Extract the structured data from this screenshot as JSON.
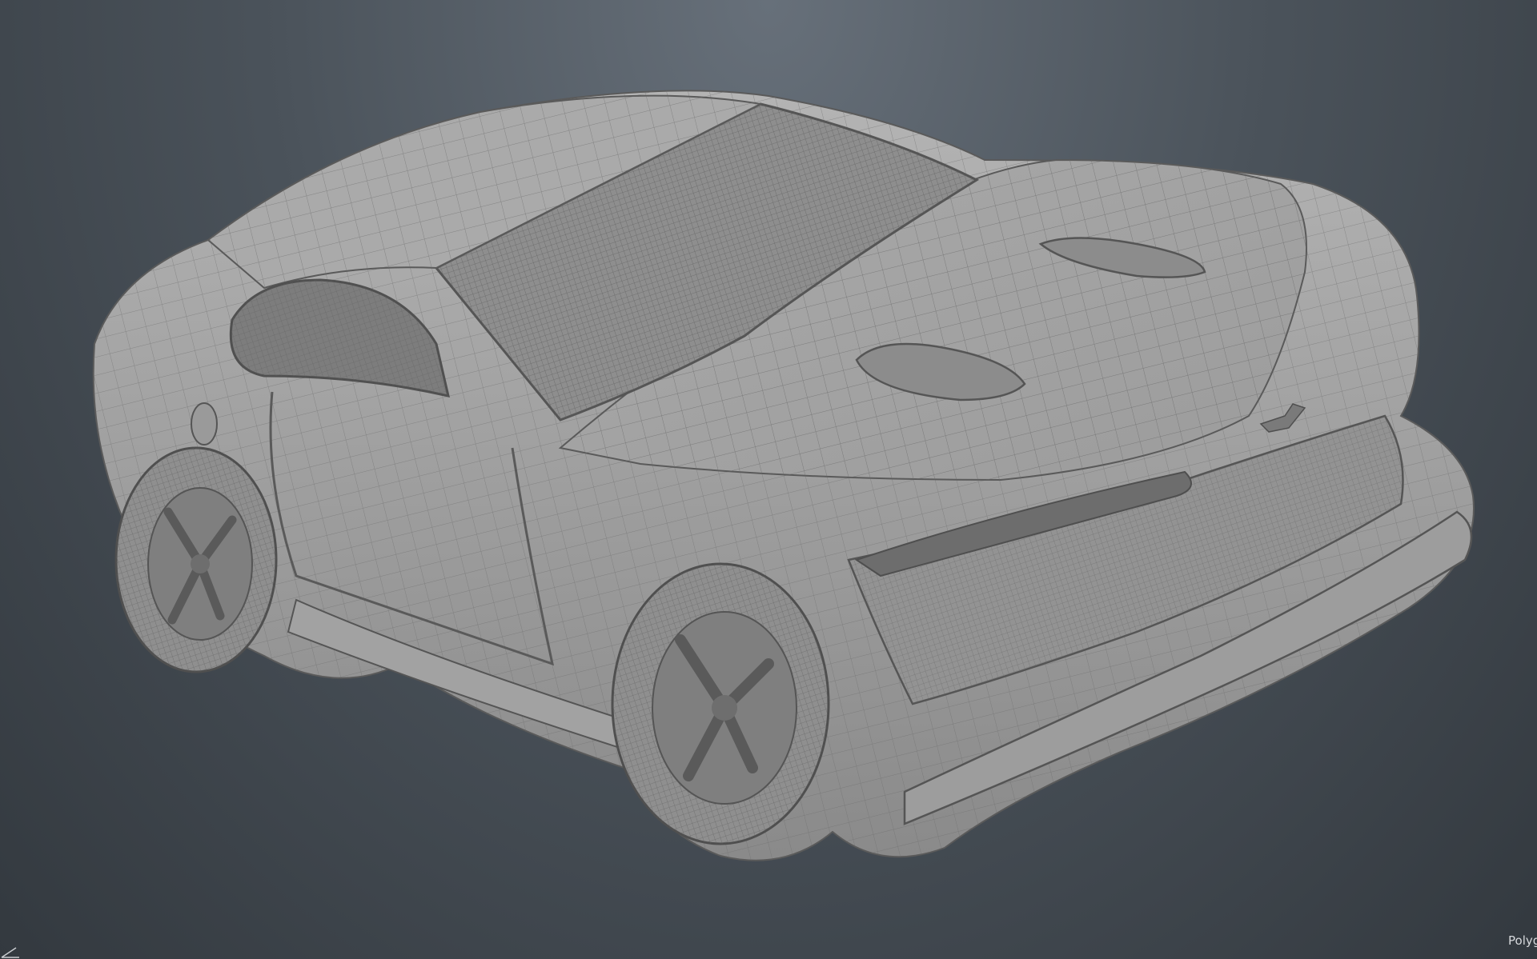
{
  "viewport": {
    "background": "#4b535b",
    "mesh_color": "#9a9a9a",
    "wire_color": "#6f6f6f",
    "status_text": "Polyg"
  },
  "icons": {
    "corner_gizmo": "axis-gizmo-icon"
  }
}
